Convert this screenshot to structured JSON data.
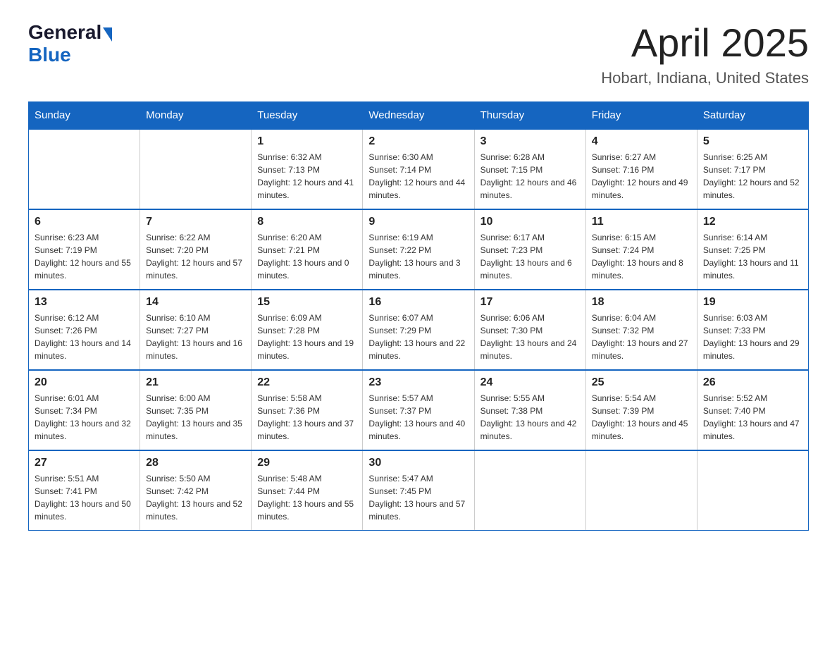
{
  "header": {
    "logo_general": "General",
    "logo_blue": "Blue",
    "month_title": "April 2025",
    "location": "Hobart, Indiana, United States"
  },
  "weekdays": [
    "Sunday",
    "Monday",
    "Tuesday",
    "Wednesday",
    "Thursday",
    "Friday",
    "Saturday"
  ],
  "weeks": [
    [
      {
        "day": "",
        "sunrise": "",
        "sunset": "",
        "daylight": ""
      },
      {
        "day": "",
        "sunrise": "",
        "sunset": "",
        "daylight": ""
      },
      {
        "day": "1",
        "sunrise": "Sunrise: 6:32 AM",
        "sunset": "Sunset: 7:13 PM",
        "daylight": "Daylight: 12 hours and 41 minutes."
      },
      {
        "day": "2",
        "sunrise": "Sunrise: 6:30 AM",
        "sunset": "Sunset: 7:14 PM",
        "daylight": "Daylight: 12 hours and 44 minutes."
      },
      {
        "day": "3",
        "sunrise": "Sunrise: 6:28 AM",
        "sunset": "Sunset: 7:15 PM",
        "daylight": "Daylight: 12 hours and 46 minutes."
      },
      {
        "day": "4",
        "sunrise": "Sunrise: 6:27 AM",
        "sunset": "Sunset: 7:16 PM",
        "daylight": "Daylight: 12 hours and 49 minutes."
      },
      {
        "day": "5",
        "sunrise": "Sunrise: 6:25 AM",
        "sunset": "Sunset: 7:17 PM",
        "daylight": "Daylight: 12 hours and 52 minutes."
      }
    ],
    [
      {
        "day": "6",
        "sunrise": "Sunrise: 6:23 AM",
        "sunset": "Sunset: 7:19 PM",
        "daylight": "Daylight: 12 hours and 55 minutes."
      },
      {
        "day": "7",
        "sunrise": "Sunrise: 6:22 AM",
        "sunset": "Sunset: 7:20 PM",
        "daylight": "Daylight: 12 hours and 57 minutes."
      },
      {
        "day": "8",
        "sunrise": "Sunrise: 6:20 AM",
        "sunset": "Sunset: 7:21 PM",
        "daylight": "Daylight: 13 hours and 0 minutes."
      },
      {
        "day": "9",
        "sunrise": "Sunrise: 6:19 AM",
        "sunset": "Sunset: 7:22 PM",
        "daylight": "Daylight: 13 hours and 3 minutes."
      },
      {
        "day": "10",
        "sunrise": "Sunrise: 6:17 AM",
        "sunset": "Sunset: 7:23 PM",
        "daylight": "Daylight: 13 hours and 6 minutes."
      },
      {
        "day": "11",
        "sunrise": "Sunrise: 6:15 AM",
        "sunset": "Sunset: 7:24 PM",
        "daylight": "Daylight: 13 hours and 8 minutes."
      },
      {
        "day": "12",
        "sunrise": "Sunrise: 6:14 AM",
        "sunset": "Sunset: 7:25 PM",
        "daylight": "Daylight: 13 hours and 11 minutes."
      }
    ],
    [
      {
        "day": "13",
        "sunrise": "Sunrise: 6:12 AM",
        "sunset": "Sunset: 7:26 PM",
        "daylight": "Daylight: 13 hours and 14 minutes."
      },
      {
        "day": "14",
        "sunrise": "Sunrise: 6:10 AM",
        "sunset": "Sunset: 7:27 PM",
        "daylight": "Daylight: 13 hours and 16 minutes."
      },
      {
        "day": "15",
        "sunrise": "Sunrise: 6:09 AM",
        "sunset": "Sunset: 7:28 PM",
        "daylight": "Daylight: 13 hours and 19 minutes."
      },
      {
        "day": "16",
        "sunrise": "Sunrise: 6:07 AM",
        "sunset": "Sunset: 7:29 PM",
        "daylight": "Daylight: 13 hours and 22 minutes."
      },
      {
        "day": "17",
        "sunrise": "Sunrise: 6:06 AM",
        "sunset": "Sunset: 7:30 PM",
        "daylight": "Daylight: 13 hours and 24 minutes."
      },
      {
        "day": "18",
        "sunrise": "Sunrise: 6:04 AM",
        "sunset": "Sunset: 7:32 PM",
        "daylight": "Daylight: 13 hours and 27 minutes."
      },
      {
        "day": "19",
        "sunrise": "Sunrise: 6:03 AM",
        "sunset": "Sunset: 7:33 PM",
        "daylight": "Daylight: 13 hours and 29 minutes."
      }
    ],
    [
      {
        "day": "20",
        "sunrise": "Sunrise: 6:01 AM",
        "sunset": "Sunset: 7:34 PM",
        "daylight": "Daylight: 13 hours and 32 minutes."
      },
      {
        "day": "21",
        "sunrise": "Sunrise: 6:00 AM",
        "sunset": "Sunset: 7:35 PM",
        "daylight": "Daylight: 13 hours and 35 minutes."
      },
      {
        "day": "22",
        "sunrise": "Sunrise: 5:58 AM",
        "sunset": "Sunset: 7:36 PM",
        "daylight": "Daylight: 13 hours and 37 minutes."
      },
      {
        "day": "23",
        "sunrise": "Sunrise: 5:57 AM",
        "sunset": "Sunset: 7:37 PM",
        "daylight": "Daylight: 13 hours and 40 minutes."
      },
      {
        "day": "24",
        "sunrise": "Sunrise: 5:55 AM",
        "sunset": "Sunset: 7:38 PM",
        "daylight": "Daylight: 13 hours and 42 minutes."
      },
      {
        "day": "25",
        "sunrise": "Sunrise: 5:54 AM",
        "sunset": "Sunset: 7:39 PM",
        "daylight": "Daylight: 13 hours and 45 minutes."
      },
      {
        "day": "26",
        "sunrise": "Sunrise: 5:52 AM",
        "sunset": "Sunset: 7:40 PM",
        "daylight": "Daylight: 13 hours and 47 minutes."
      }
    ],
    [
      {
        "day": "27",
        "sunrise": "Sunrise: 5:51 AM",
        "sunset": "Sunset: 7:41 PM",
        "daylight": "Daylight: 13 hours and 50 minutes."
      },
      {
        "day": "28",
        "sunrise": "Sunrise: 5:50 AM",
        "sunset": "Sunset: 7:42 PM",
        "daylight": "Daylight: 13 hours and 52 minutes."
      },
      {
        "day": "29",
        "sunrise": "Sunrise: 5:48 AM",
        "sunset": "Sunset: 7:44 PM",
        "daylight": "Daylight: 13 hours and 55 minutes."
      },
      {
        "day": "30",
        "sunrise": "Sunrise: 5:47 AM",
        "sunset": "Sunset: 7:45 PM",
        "daylight": "Daylight: 13 hours and 57 minutes."
      },
      {
        "day": "",
        "sunrise": "",
        "sunset": "",
        "daylight": ""
      },
      {
        "day": "",
        "sunrise": "",
        "sunset": "",
        "daylight": ""
      },
      {
        "day": "",
        "sunrise": "",
        "sunset": "",
        "daylight": ""
      }
    ]
  ]
}
